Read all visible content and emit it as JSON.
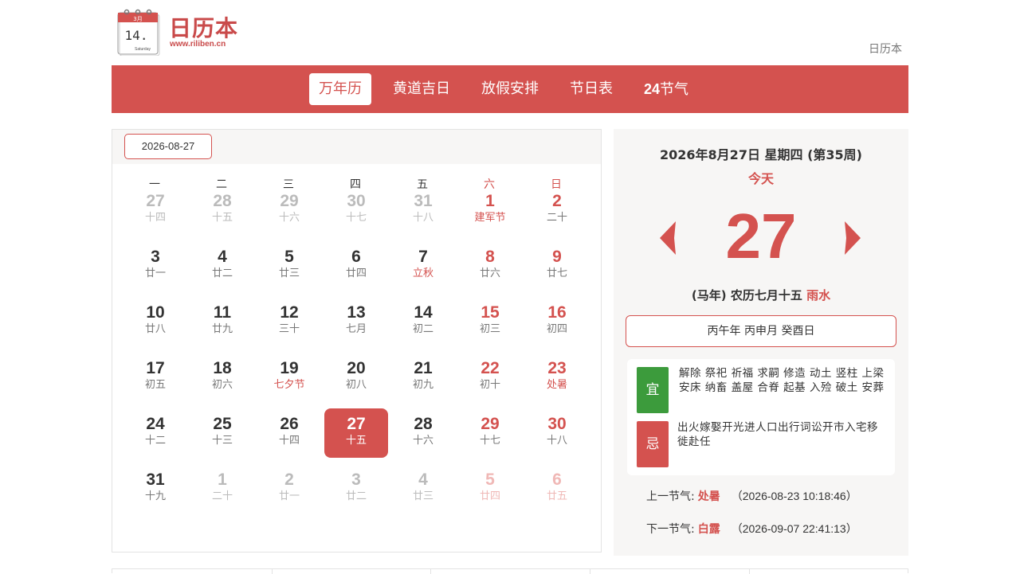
{
  "header": {
    "logo_icon_month": "3月",
    "logo_icon_day": "14.",
    "logo_icon_weekday": "Saturday",
    "logo_title": "日历本",
    "logo_url": "www.riliben.cn",
    "top_link": "日历本"
  },
  "nav": {
    "items": [
      {
        "label": "万年历",
        "active": true
      },
      {
        "label": "黄道吉日",
        "active": false
      },
      {
        "label": "放假安排",
        "active": false
      },
      {
        "label": "节日表",
        "active": false
      },
      {
        "label_num": "24",
        "label_text": "节气",
        "active": false
      }
    ]
  },
  "calendar": {
    "date_input": "2026-08-27",
    "weekdays": [
      "一",
      "二",
      "三",
      "四",
      "五",
      "六",
      "日"
    ],
    "weeks": [
      [
        {
          "d": "27",
          "l": "十四",
          "other": true
        },
        {
          "d": "28",
          "l": "十五",
          "other": true
        },
        {
          "d": "29",
          "l": "十六",
          "other": true
        },
        {
          "d": "30",
          "l": "十七",
          "other": true
        },
        {
          "d": "31",
          "l": "十八",
          "other": true
        },
        {
          "d": "1",
          "l": "建军节",
          "fest": true
        },
        {
          "d": "2",
          "l": "二十"
        }
      ],
      [
        {
          "d": "3",
          "l": "廿一"
        },
        {
          "d": "4",
          "l": "廿二"
        },
        {
          "d": "5",
          "l": "廿三"
        },
        {
          "d": "6",
          "l": "廿四"
        },
        {
          "d": "7",
          "l": "立秋",
          "fest": true
        },
        {
          "d": "8",
          "l": "廿六"
        },
        {
          "d": "9",
          "l": "廿七"
        }
      ],
      [
        {
          "d": "10",
          "l": "廿八"
        },
        {
          "d": "11",
          "l": "廿九"
        },
        {
          "d": "12",
          "l": "三十"
        },
        {
          "d": "13",
          "l": "七月"
        },
        {
          "d": "14",
          "l": "初二"
        },
        {
          "d": "15",
          "l": "初三"
        },
        {
          "d": "16",
          "l": "初四"
        }
      ],
      [
        {
          "d": "17",
          "l": "初五"
        },
        {
          "d": "18",
          "l": "初六"
        },
        {
          "d": "19",
          "l": "七夕节",
          "fest": true
        },
        {
          "d": "20",
          "l": "初八"
        },
        {
          "d": "21",
          "l": "初九"
        },
        {
          "d": "22",
          "l": "初十"
        },
        {
          "d": "23",
          "l": "处暑",
          "fest": true
        }
      ],
      [
        {
          "d": "24",
          "l": "十二"
        },
        {
          "d": "25",
          "l": "十三"
        },
        {
          "d": "26",
          "l": "十四"
        },
        {
          "d": "27",
          "l": "十五",
          "selected": true
        },
        {
          "d": "28",
          "l": "十六"
        },
        {
          "d": "29",
          "l": "十七"
        },
        {
          "d": "30",
          "l": "十八"
        }
      ],
      [
        {
          "d": "31",
          "l": "十九"
        },
        {
          "d": "1",
          "l": "二十",
          "other": true
        },
        {
          "d": "2",
          "l": "廿一",
          "other": true
        },
        {
          "d": "3",
          "l": "廿二",
          "other": true
        },
        {
          "d": "4",
          "l": "廿三",
          "other": true
        },
        {
          "d": "5",
          "l": "廿四",
          "other": true
        },
        {
          "d": "6",
          "l": "廿五",
          "other": true
        }
      ]
    ]
  },
  "detail": {
    "date_line": "2026年8月27日 星期四 (第35周)",
    "today_label": "今天",
    "big_day": "27",
    "lunar_prefix": "(马年) 农历七月十五",
    "solar_term": "雨水",
    "ganzhi": "丙午年 丙申月 癸酉日",
    "yi_label": "宜",
    "yi_text": "解除 祭祀 祈福 求嗣 修造 动土 竖柱 上梁 安床 纳畜 盖屋 合脊 起基 入殓 破土 安葬",
    "ji_label": "忌",
    "ji_text": "出火嫁娶开光进人口出行词讼开市入宅移徙赴任",
    "prev_term_label": "上一节气:",
    "prev_term_name": "处暑",
    "prev_term_time": "（2026-08-23 10:18:46）",
    "next_term_label": "下一节气:",
    "next_term_name": "白露",
    "next_term_time": "（2026-09-07 22:41:13）"
  },
  "colors": {
    "accent": "#d4524f",
    "yi_green": "#3c9b3c",
    "panel_bg": "#f7f6f5"
  }
}
